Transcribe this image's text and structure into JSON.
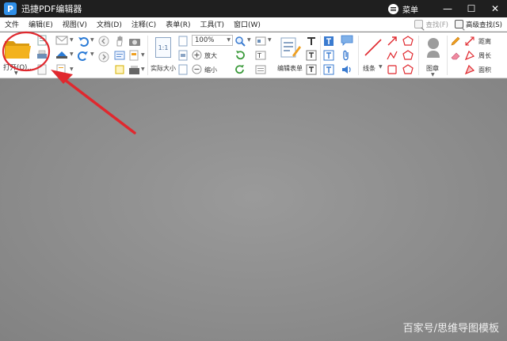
{
  "app": {
    "logo_letter": "P",
    "title": "迅捷PDF编辑器",
    "menu_label": "菜单",
    "win_minimize": "—",
    "win_maximize": "☐",
    "win_close": "✕"
  },
  "menubar": {
    "items": [
      "文件",
      "编辑(E)",
      "视图(V)",
      "文档(D)",
      "注释(C)",
      "表单(R)",
      "工具(T)",
      "窗口(W)"
    ],
    "search_label": "查找(F)",
    "advanced_search_label": "高级查找(S)"
  },
  "toolbar": {
    "open_label": "打开(O)...",
    "actual_size_label": "实际大小",
    "actual_size_icon_text": "1:1",
    "zoom_value": "100%",
    "zoom_in_label": "放大",
    "zoom_out_label": "缩小",
    "edit_form_label": "编辑表单",
    "line_label": "线条",
    "stamp_label": "图章",
    "distance_label": "距离",
    "perimeter_label": "周长",
    "area_label": "面积"
  },
  "watermark": "百家号/思维导图模板",
  "colors": {
    "titlebar": "#1f1f1f",
    "annotation_red": "#e0282e",
    "folder_yellow": "#f3b21d",
    "workspace": "#8f8f8f"
  }
}
